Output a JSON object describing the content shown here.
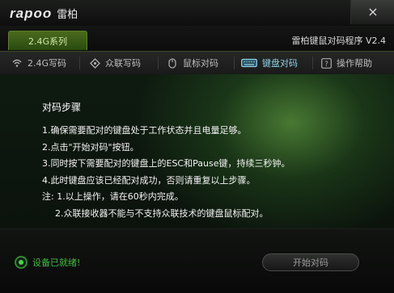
{
  "titlebar": {
    "logo_text": "rapoo",
    "logo_cn": "雷柏",
    "close_label": "×"
  },
  "tabs": {
    "main_tab_label": "2.4G系列",
    "app_title": "雷柏键鼠对码程序 V2.4"
  },
  "nav": {
    "items": [
      {
        "label": "2.4G写码",
        "icon": "wifi-icon"
      },
      {
        "label": "众联写码",
        "icon": "diamond-icon"
      },
      {
        "label": "鼠标对码",
        "icon": "mouse-icon"
      },
      {
        "label": "键盘对码",
        "icon": "keyboard-icon"
      },
      {
        "label": "操作帮助",
        "icon": "help-icon"
      }
    ],
    "active_index": 3
  },
  "content": {
    "title": "对码步骤",
    "steps": [
      "1.确保需要配对的键盘处于工作状态并且电量足够。",
      "2.点击\"开始对码\"按钮。",
      "3.同时按下需要配对的键盘上的ESC和Pause键，持续三秒钟。",
      "4.此时键盘应该已经配对成功，否则请重复以上步骤。",
      "注: 1.以上操作，请在60秒内完成。",
      "2.众联接收器不能与不支持众联技术的键盘鼠标配对。"
    ]
  },
  "footer": {
    "status_text": "设备已就绪!",
    "start_button_label": "开始对码"
  },
  "colors": {
    "accent_green": "#4a6b1c",
    "status_green": "#3fbf3f",
    "active_nav": "#8fd2e6"
  }
}
